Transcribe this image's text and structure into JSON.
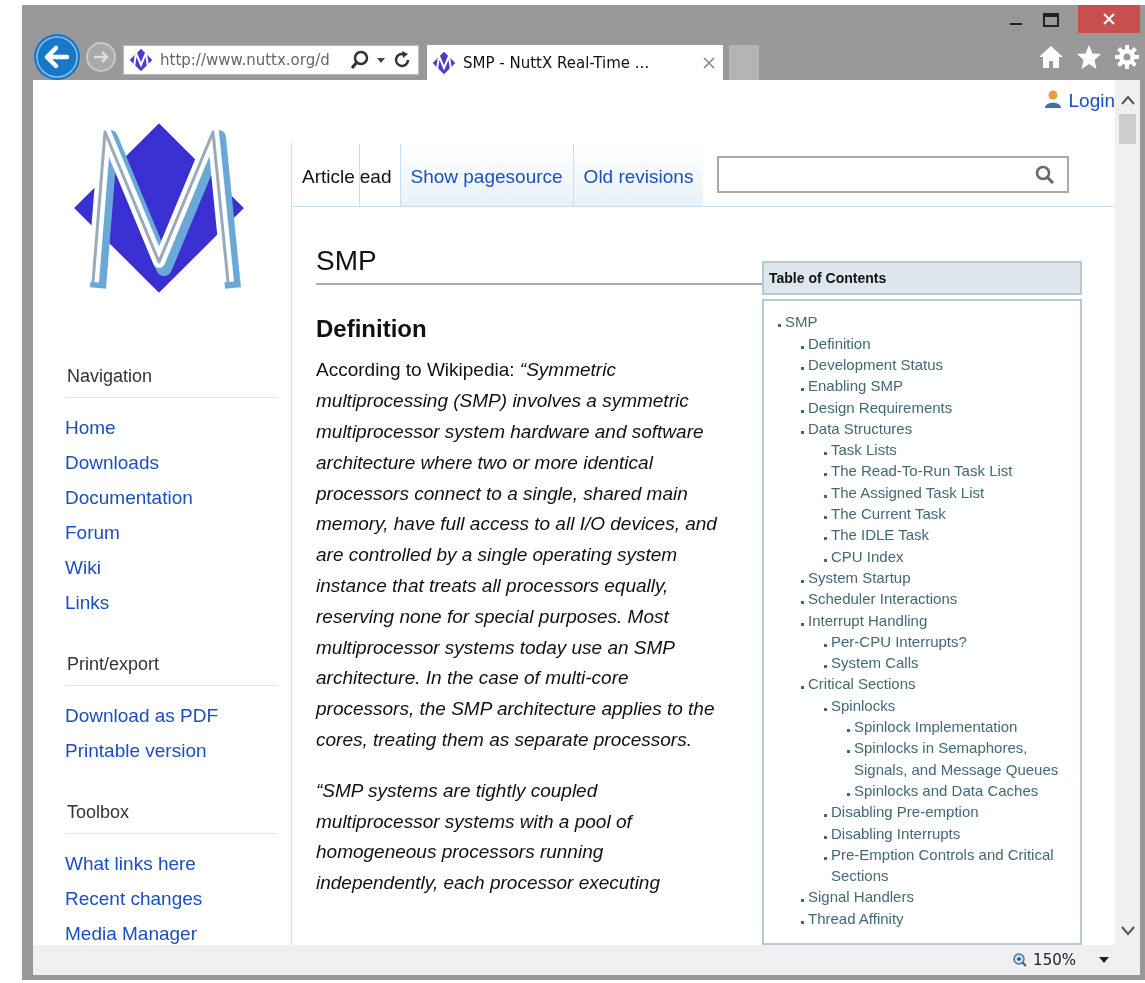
{
  "browser": {
    "address": "http://www.nuttx.org/d",
    "tab_title": "SMP - NuttX Real-Time ...",
    "zoom": "150%"
  },
  "user": {
    "login": "Login"
  },
  "tabs": [
    {
      "label": "Article",
      "selected": true
    },
    {
      "label": "ead",
      "selected": true
    },
    {
      "label": "Show pagesource",
      "selected": false
    },
    {
      "label": "Old revisions",
      "selected": false
    }
  ],
  "sidebar": [
    {
      "heading": "Navigation",
      "links": [
        "Home",
        "Downloads",
        "Documentation",
        "Forum",
        "Wiki",
        "Links"
      ]
    },
    {
      "heading": "Print/export",
      "links": [
        "Download as PDF",
        "Printable version"
      ]
    },
    {
      "heading": "Toolbox",
      "links": [
        "What links here",
        "Recent changes",
        "Media Manager"
      ]
    }
  ],
  "article": {
    "title": "SMP",
    "section": "Definition",
    "paragraphs": [
      "According to Wikipedia: *“Symmetric multiprocessing (SMP) involves a symmetric multiprocessor system hardware and software architecture where two or more identical processors connect to a single, shared main memory, have full access to all I/O devices, and are controlled by a single operating system instance that treats all processors equally, reserving none for special purposes. Most multiprocessor systems today use an SMP architecture. In the case of multi-core processors, the SMP architecture applies to the cores, treating them as separate processors.*",
      "*“SMP systems are tightly coupled multiprocessor systems with a pool of homogeneous processors running independently, each processor executing*"
    ]
  },
  "toc": {
    "title": "Table of Contents",
    "items": [
      {
        "label": "SMP",
        "children": [
          {
            "label": "Definition"
          },
          {
            "label": "Development Status"
          },
          {
            "label": "Enabling SMP"
          },
          {
            "label": "Design Requirements"
          },
          {
            "label": "Data Structures",
            "children": [
              {
                "label": "Task Lists"
              },
              {
                "label": "The Read-To-Run Task List"
              },
              {
                "label": "The Assigned Task List"
              },
              {
                "label": "The Current Task"
              },
              {
                "label": "The IDLE Task"
              },
              {
                "label": "CPU Index"
              }
            ]
          },
          {
            "label": "System Startup"
          },
          {
            "label": "Scheduler Interactions"
          },
          {
            "label": "Interrupt Handling",
            "children": [
              {
                "label": "Per-CPU Interrupts?"
              },
              {
                "label": "System Calls"
              }
            ]
          },
          {
            "label": "Critical Sections",
            "children": [
              {
                "label": "Spinlocks",
                "children": [
                  {
                    "label": "Spinlock Implementation"
                  },
                  {
                    "label": "Spinlocks in Semaphores, Signals, and Message Queues"
                  },
                  {
                    "label": "Spinlocks and Data Caches"
                  }
                ]
              },
              {
                "label": "Disabling Pre-emption"
              },
              {
                "label": "Disabling Interrupts"
              },
              {
                "label": "Pre-Emption Controls and Critical Sections"
              }
            ]
          },
          {
            "label": "Signal Handlers"
          },
          {
            "label": "Thread Affinity"
          }
        ]
      }
    ]
  }
}
